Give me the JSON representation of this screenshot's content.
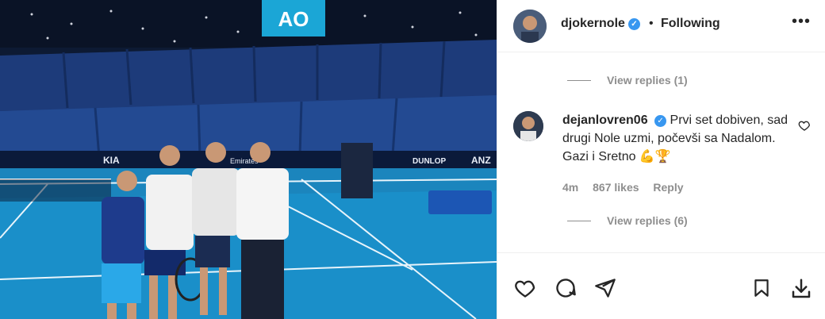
{
  "post": {
    "author": "djokernole",
    "follow_state": "Following",
    "separator": "•",
    "more_label": "•••",
    "photo_signs": {
      "scoreboard": "AO",
      "sponsor_1": "KIA",
      "sponsor_2": "DUNLOP",
      "sponsor_3": "ANZ",
      "sponsor_4": "Emirates"
    }
  },
  "replies_top": {
    "label": "View replies (1)"
  },
  "comment": {
    "user": "dejanlovren06",
    "text": "Prvi set dobiven, sad drugi Nole uzmi, počevši sa Nadalom. Gazi i Sretno 💪🏆",
    "time": "4m",
    "likes": "867 likes",
    "reply_label": "Reply"
  },
  "replies_bottom": {
    "label": "View replies (6)"
  },
  "colors": {
    "court": "#1a8fc9",
    "verified": "#3897f0",
    "muted": "#8e8e8e"
  }
}
